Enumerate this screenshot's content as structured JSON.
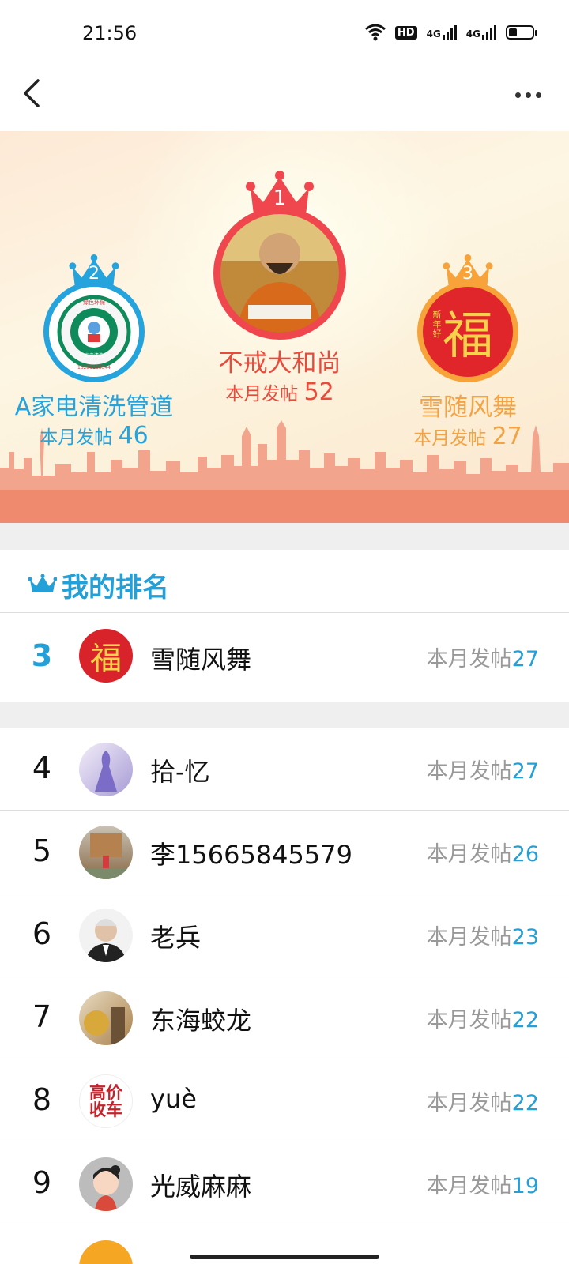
{
  "status_bar": {
    "time": "21:56",
    "network": "4G",
    "hd": "HD"
  },
  "podium": {
    "first": {
      "rank": "1",
      "name": "不戒大和尚",
      "posts_label": "本月发帖",
      "posts": "52"
    },
    "second": {
      "rank": "2",
      "name": "A家电清洗管道",
      "posts_label": "本月发帖",
      "posts": "46",
      "badge": {
        "top": "绿色环保",
        "ring": "13256165544",
        "center": "家电清洗"
      }
    },
    "third": {
      "rank": "3",
      "name": "雪随风舞",
      "posts_label": "本月发帖",
      "posts": "27",
      "fu": "福",
      "small": "新年好"
    }
  },
  "my_rank": {
    "title": "我的排名",
    "entry": {
      "rank": "3",
      "name": "雪随风舞",
      "posts_label": "本月发帖",
      "posts": "27",
      "fu": "福"
    }
  },
  "ranking": [
    {
      "rank": "4",
      "name": "拾-忆",
      "posts_label": "本月发帖",
      "posts": "27"
    },
    {
      "rank": "5",
      "name": "李15665845579",
      "posts_label": "本月发帖",
      "posts": "26"
    },
    {
      "rank": "6",
      "name": "老兵",
      "posts_label": "本月发帖",
      "posts": "23"
    },
    {
      "rank": "7",
      "name": "东海蛟龙",
      "posts_label": "本月发帖",
      "posts": "22"
    },
    {
      "rank": "8",
      "name": "yuè",
      "posts_label": "本月发帖",
      "posts": "22",
      "avatar_text": "高价收车"
    },
    {
      "rank": "9",
      "name": "光威麻麻",
      "posts_label": "本月发帖",
      "posts": "19"
    }
  ],
  "colors": {
    "accent_blue": "#23a0d8",
    "gold_red": "#f0474e",
    "silver_blue": "#25a3dc",
    "bronze_orange": "#f7a33a"
  }
}
